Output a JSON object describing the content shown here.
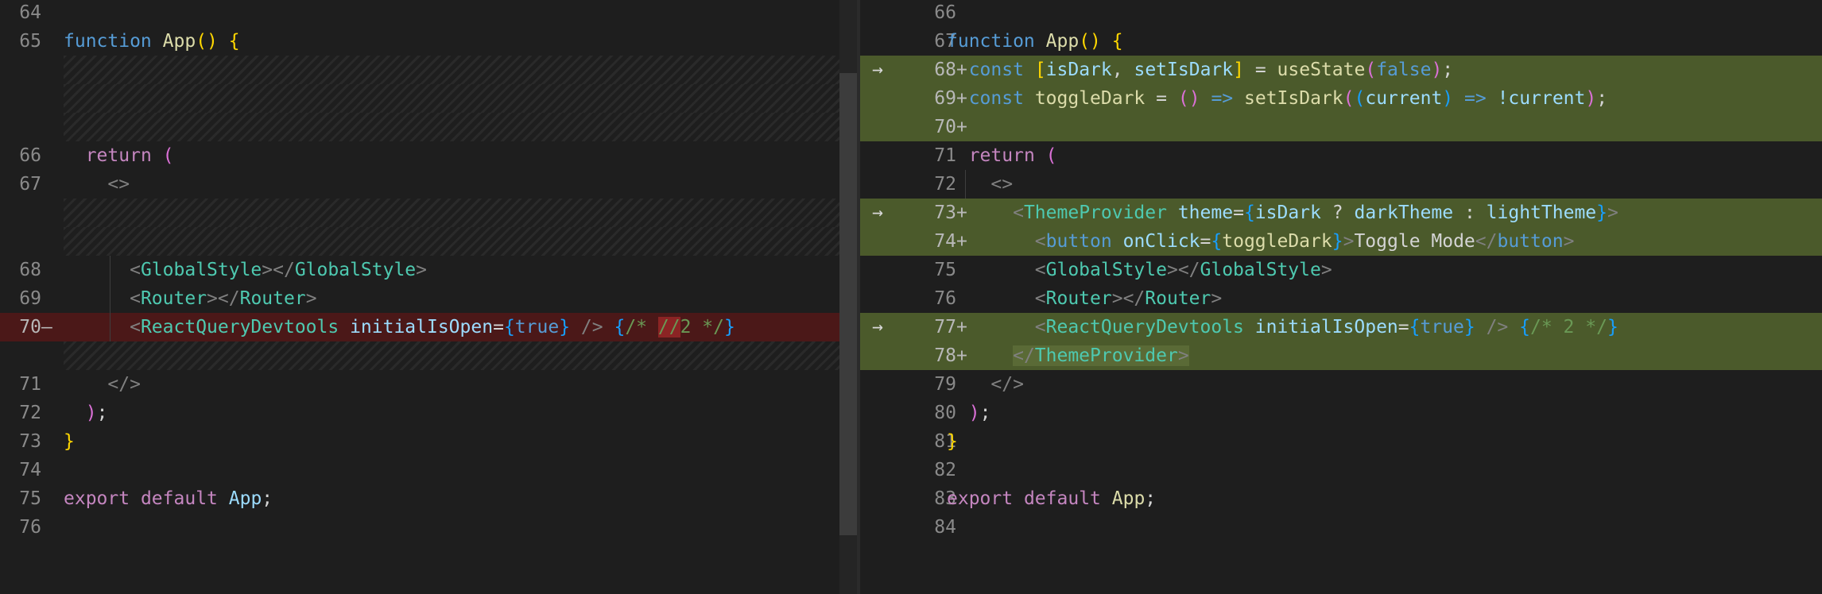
{
  "left": {
    "line_numbers": [
      "64",
      "65",
      "",
      "",
      "",
      "66",
      "67",
      "",
      "",
      "68",
      "69",
      "70",
      "",
      "71",
      "72",
      "73",
      "74",
      "75",
      "76"
    ],
    "removed_marker": "—",
    "code": {
      "func_kw": "function",
      "func_name": "App",
      "open_paren": "(",
      "close_paren": ")",
      "brace_open": "{",
      "return_kw": "return",
      "return_paren": "(",
      "frag_open": "<>",
      "gs_lt": "<",
      "gs_tag": "GlobalStyle",
      "gs_mid": "></",
      "gs_tag2": "GlobalStyle",
      "gs_gt": ">",
      "rt_lt": "<",
      "rt_tag": "Router",
      "rt_mid": "></",
      "rt_tag2": "Router",
      "rt_gt": ">",
      "rq_lt": "<",
      "rq_tag": "ReactQueryDevtools",
      "rq_attr": "initialIsOpen",
      "rq_eq": "=",
      "rq_bo": "{",
      "rq_true": "true",
      "rq_bc": "}",
      "rq_close": " />",
      "rq_cm_bo": "{",
      "rq_cm_a": "/* ",
      "rq_cm_del": "//",
      "rq_cm_b": "2 */",
      "rq_cm_bc": "}",
      "frag_close": "</>",
      "close_paren2": ")",
      "semi": ";",
      "brace_close": "}",
      "export_kw": "export",
      "default_kw": "default",
      "export_name": "App",
      "export_semi": ";"
    }
  },
  "right": {
    "line_numbers": [
      "66",
      "67",
      "68",
      "69",
      "70",
      "71",
      "72",
      "73",
      "74",
      "75",
      "76",
      "77",
      "78",
      "79",
      "80",
      "81",
      "82",
      "83",
      "84"
    ],
    "added_marker": "+",
    "arrow": "→",
    "code": {
      "func_kw": "function",
      "func_name": "App",
      "open_paren": "(",
      "close_paren": ")",
      "brace_open": "{",
      "const1": "const",
      "arr_open": "[",
      "isDark": "isDark",
      "comma": ",",
      "setIsDark": "setIsDark",
      "arr_close": "]",
      "eq1": "=",
      "useState": "useState",
      "us_po": "(",
      "false_kw": "false",
      "us_pc": ")",
      "semi1": ";",
      "const2": "const",
      "toggleDark": "toggleDark",
      "eq2": "=",
      "arrow_po": "(",
      "arrow_pc": ")",
      "arrow_op": "=>",
      "setIsDark2": "setIsDark",
      "call_po": "(",
      "inner_po": "(",
      "current": "current",
      "inner_pc": ")",
      "arrow_op2": "=>",
      "not_current": "!current",
      "call_pc": ")",
      "semi2": ";",
      "return_kw": "return",
      "return_paren": "(",
      "frag_open": "<>",
      "tp_lt": "<",
      "tp_tag": "ThemeProvider",
      "tp_attr": "theme",
      "tp_eq": "=",
      "tp_bo": "{",
      "tp_isDark": "isDark",
      "tp_q": "?",
      "tp_dark": "darkTheme",
      "tp_colon": ":",
      "tp_light": "lightTheme",
      "tp_bc": "}",
      "tp_gt": ">",
      "bt_lt": "<",
      "bt_tag": "button",
      "bt_attr": "onClick",
      "bt_eq": "=",
      "bt_bo": "{",
      "bt_fn": "toggleDark",
      "bt_bc": "}",
      "bt_gt": ">",
      "bt_text": "Toggle Mode",
      "bt_close_lt": "</",
      "bt_close_tag": "button",
      "bt_close_gt": ">",
      "gs_lt": "<",
      "gs_tag": "GlobalStyle",
      "gs_mid": "></",
      "gs_tag2": "GlobalStyle",
      "gs_gt": ">",
      "rt_lt": "<",
      "rt_tag": "Router",
      "rt_mid": "></",
      "rt_tag2": "Router",
      "rt_gt": ">",
      "rq_lt": "<",
      "rq_tag": "ReactQueryDevtools",
      "rq_attr": "initialIsOpen",
      "rq_eq": "=",
      "rq_bo": "{",
      "rq_true": "true",
      "rq_bc": "}",
      "rq_close": " />",
      "rq_cm_bo": "{",
      "rq_cm": "/* 2 */",
      "rq_cm_bc": "}",
      "tp_close_lt": "</",
      "tp_close_tag": "ThemeProvider",
      "tp_close_gt": ">",
      "frag_close": "</>",
      "close_paren2": ")",
      "semi3": ";",
      "brace_close": "}",
      "export_kw": "export",
      "default_kw": "default",
      "export_name": "App",
      "export_semi": ";"
    }
  },
  "colors": {
    "background": "#1e1e1e",
    "removed_line": "#4b1818",
    "removed_char": "#8b2424",
    "added_line": "#4b5a2b"
  }
}
